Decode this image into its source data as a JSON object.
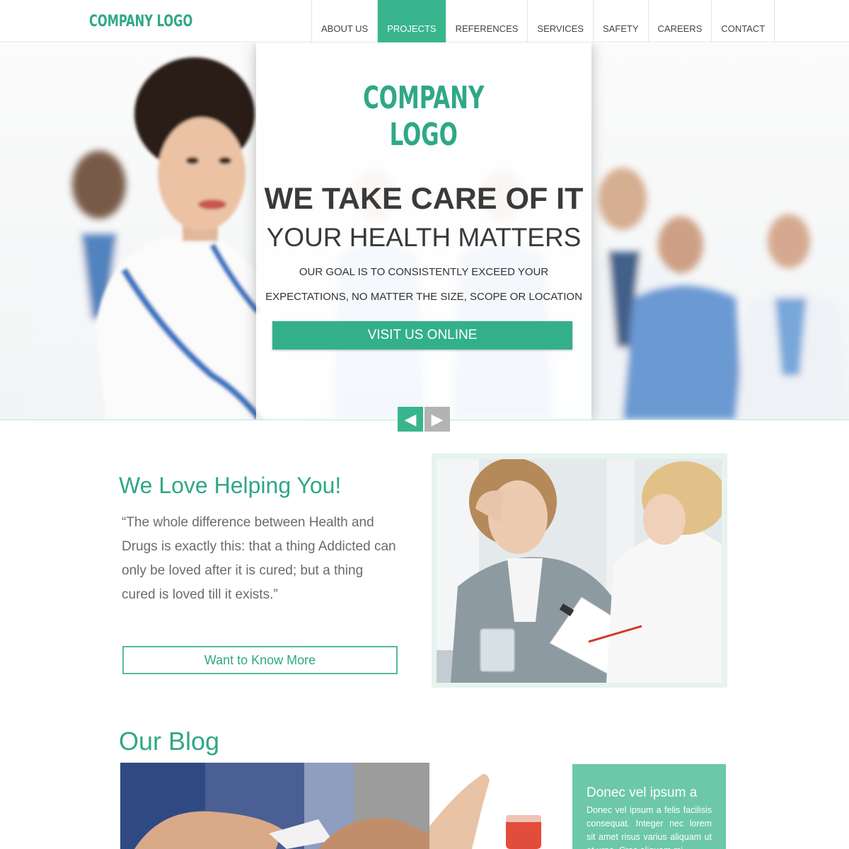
{
  "header": {
    "logo": "COMPANY LOGO",
    "nav": [
      {
        "label": "ABOUT US",
        "active": false
      },
      {
        "label": "PROJECTS",
        "active": true
      },
      {
        "label": "REFERENCES",
        "active": false
      },
      {
        "label": "SERVICES",
        "active": false
      },
      {
        "label": "SAFETY",
        "active": false
      },
      {
        "label": "CAREERS",
        "active": false
      },
      {
        "label": "CONTACT",
        "active": false
      }
    ]
  },
  "hero": {
    "logo_line1": "COMPANY",
    "logo_line2": "LOGO",
    "headline": "WE TAKE CARE OF IT",
    "subheadline": "YOUR HEALTH MATTERS",
    "description": "OUR GOAL IS TO CONSISTENTLY EXCEED YOUR EXPECTATIONS, NO MATTER THE SIZE, SCOPE OR LOCATION",
    "cta_label": "VISIT US ONLINE",
    "prev_icon": "◀",
    "next_icon": "▶"
  },
  "about": {
    "title": "We Love Helping You!",
    "quote": "“The whole difference between Health  and Drugs is exactly this: that a thing Addicted can only be loved after it is cured; but a thing cured is loved till it exists.”",
    "button_label": "Want to Know More"
  },
  "blog": {
    "title": "Our Blog",
    "card_title": "Donec vel ipsum a",
    "card_text": "Donec vel ipsum a felis facilisis consequat. Integer nec lorem sit amet risus varius aliquam ut et urna. Cras aliquam mi"
  },
  "colors": {
    "accent": "#39b58d",
    "accent_text": "#2fa885",
    "card_bg": "#6cc8a8",
    "arrow_inactive": "#b3b3b3"
  }
}
